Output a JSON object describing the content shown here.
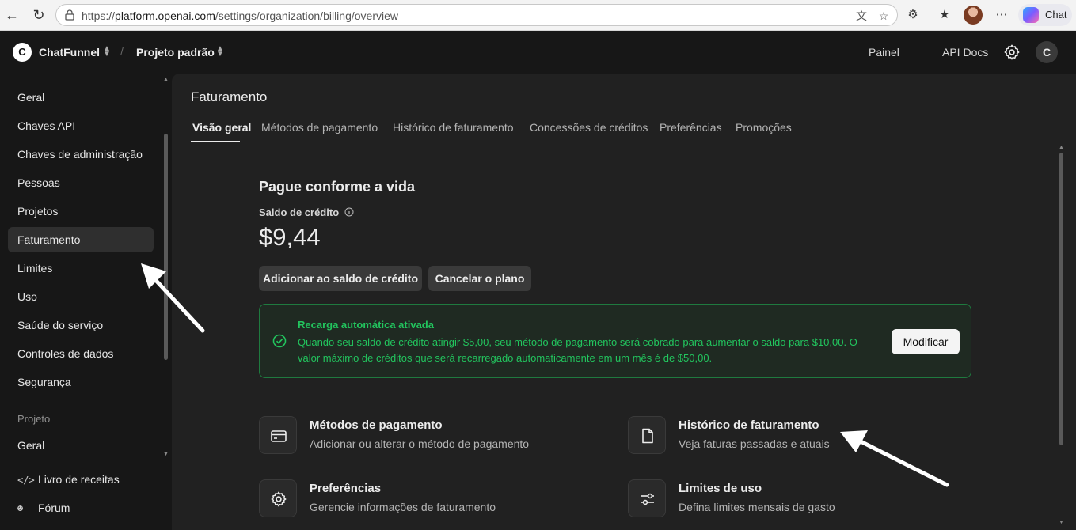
{
  "browser": {
    "url_prefix": "https://",
    "url_host": "platform.openai.com",
    "url_path": "/settings/organization/billing/overview",
    "copilot_label": "Chat"
  },
  "header": {
    "org_initial": "C",
    "org_name": "ChatFunnel",
    "separator": "/",
    "project_name": "Projeto padrão",
    "links": [
      "Painel",
      "API Docs"
    ],
    "user_initial": "C"
  },
  "sidebar": {
    "items": [
      {
        "label": "Geral"
      },
      {
        "label": "Chaves API"
      },
      {
        "label": "Chaves de administração"
      },
      {
        "label": "Pessoas"
      },
      {
        "label": "Projetos"
      },
      {
        "label": "Faturamento",
        "active": true
      },
      {
        "label": "Limites"
      },
      {
        "label": "Uso"
      },
      {
        "label": "Saúde do serviço"
      },
      {
        "label": "Controles de dados"
      },
      {
        "label": "Segurança"
      }
    ],
    "section_label": "Projeto",
    "section_items": [
      {
        "label": "Geral"
      }
    ],
    "bottom": [
      {
        "label": "Livro de receitas",
        "icon": "code-icon"
      },
      {
        "label": "Fórum",
        "icon": "people-icon"
      }
    ]
  },
  "main": {
    "title": "Faturamento",
    "tabs": [
      "Visão geral",
      "Métodos de pagamento",
      "Histórico de faturamento",
      "Concessões de créditos",
      "Preferências",
      "Promoções"
    ],
    "active_tab": "Visão geral",
    "plan_title": "Pague conforme a vida",
    "credit_label": "Saldo de crédito",
    "credit_value": "$9,44",
    "buttons": {
      "add_credit": "Adicionar ao saldo de crédito",
      "cancel_plan": "Cancelar o plano",
      "modify": "Modificar"
    },
    "auto_recharge": {
      "title": "Recarga automática ativada",
      "description": "Quando seu saldo de crédito atingir $5,00, seu método de pagamento será cobrado para aumentar o saldo para $10,00. O valor máximo de créditos que será recarregado automaticamente em um mês é de $50,00.",
      "color": "#22c55e"
    },
    "cards": [
      {
        "title": "Métodos de pagamento",
        "subtitle": "Adicionar ou alterar o método de pagamento",
        "icon": "credit-card-icon"
      },
      {
        "title": "Histórico de faturamento",
        "subtitle": "Veja faturas passadas e atuais",
        "icon": "document-icon"
      },
      {
        "title": "Preferências",
        "subtitle": "Gerencie informações de faturamento",
        "icon": "gear-icon"
      },
      {
        "title": "Limites de uso",
        "subtitle": "Defina limites mensais de gasto",
        "icon": "sliders-icon"
      }
    ]
  }
}
